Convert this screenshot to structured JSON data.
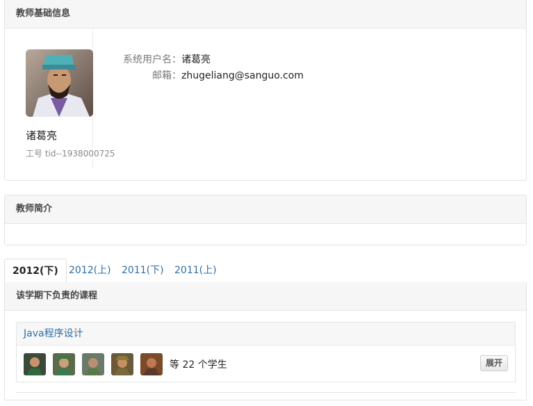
{
  "profile": {
    "panel_title": "教师基础信息",
    "name": "诸葛亮",
    "teacher_id": "工号 tid--1938000725",
    "username_label": "系统用户名：",
    "username": "诸葛亮",
    "email_label": "邮箱：",
    "email": "zhugeliang@sanguo.com"
  },
  "intro": {
    "panel_title": "教师简介"
  },
  "tabs": [
    "2012(下)",
    "2012(上)",
    "2011(下)",
    "2011(上)"
  ],
  "courses_panel": {
    "title": "该学期下负责的课程",
    "courses": [
      {
        "name": "Java程序设计",
        "student_count": "等 22 个学生",
        "expand_label": "展开"
      }
    ]
  }
}
